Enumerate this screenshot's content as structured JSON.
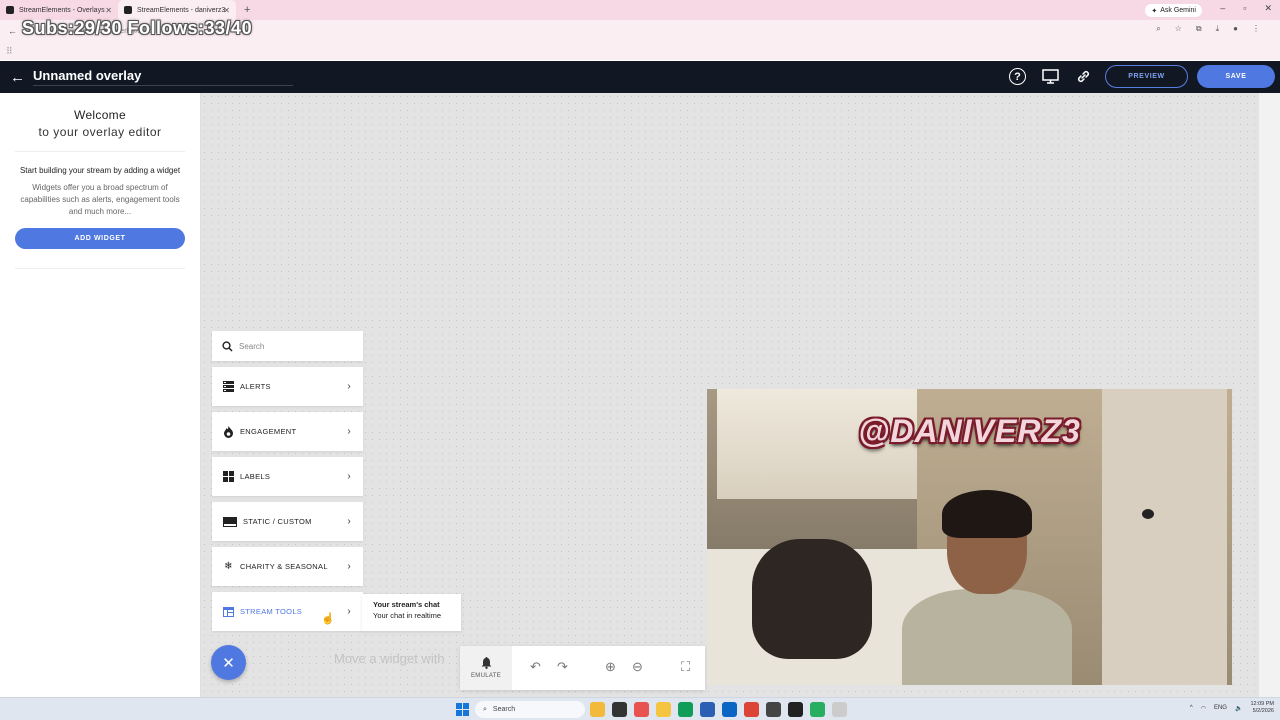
{
  "browser": {
    "tabs": [
      {
        "title": "StreamElements - Overlays",
        "active": false
      },
      {
        "title": "StreamElements - daniverz3",
        "active": true
      }
    ],
    "new_tab_label": "+",
    "gemini_label": "Ask Gemini",
    "url": "streamelements.com/overlay/editor"
  },
  "stream_overlay": {
    "counter_text": "Subs:29/30   Follows:33/40"
  },
  "header": {
    "title": "Unnamed overlay",
    "preview_label": "PREVIEW",
    "save_label": "SAVE"
  },
  "left_panel": {
    "welcome_line1": "Welcome",
    "welcome_line2": "to your overlay editor",
    "start_text": "Start building your stream by adding a widget",
    "description": "Widgets offer you a broad spectrum of capabilities such as alerts, engagement tools and much more...",
    "add_widget_label": "ADD WIDGET"
  },
  "widget_menu": {
    "search_placeholder": "Search",
    "items": [
      {
        "label": "ALERTS",
        "icon": "alerts-icon"
      },
      {
        "label": "ENGAGEMENT",
        "icon": "flame-icon"
      },
      {
        "label": "LABELS",
        "icon": "labels-icon"
      },
      {
        "label": "STATIC / CUSTOM",
        "icon": "static-icon"
      },
      {
        "label": "CHARITY & SEASONAL",
        "icon": "snowflake-icon"
      },
      {
        "label": "STREAM TOOLS",
        "icon": "stream-tools-icon",
        "active": true
      }
    ],
    "tooltip_title": "Your stream's chat",
    "tooltip_subtitle": "Your chat in realtime"
  },
  "canvas": {
    "hint_text": "Move a widget with"
  },
  "toolbar": {
    "emulate_label": "EMULATE"
  },
  "webcam": {
    "name_overlay": "@DANIVERZ3"
  },
  "taskbar": {
    "search_label": "Search",
    "language": "ENG",
    "time": "12:09 PM",
    "date": "5/2/2026"
  },
  "colors": {
    "accent": "#4f78e0",
    "header_bg": "#111823",
    "canvas_bg": "#e3e3e3"
  }
}
